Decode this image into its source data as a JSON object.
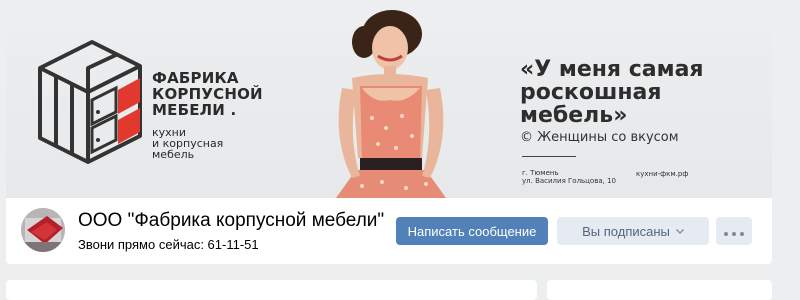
{
  "cover": {
    "logo_title_lines": [
      "ФАБРИКА",
      "КОРПУСНОЙ",
      "МЕБЕЛИ ."
    ],
    "logo_sub_lines": [
      "кухни",
      "и корпусная",
      "мебель"
    ],
    "quote_lines": [
      "«У меня самая",
      "роскошная",
      "мебель»"
    ],
    "quote_author": "© Женщины со вкусом",
    "address_lines": [
      "г. Тюмень",
      "ул. Василия Гольцова, 10"
    ],
    "website": "кухни-фкм.рф"
  },
  "group": {
    "name": "ООО \"Фабрика корпусной мебели\"",
    "status": "Звони прямо сейчас: 61-11-51"
  },
  "actions": {
    "message_label": "Написать сообщение",
    "subscribed_label": "Вы подписаны",
    "subscribed_chevron_icon": "chevron-down-icon",
    "more_icon": "more-dots-icon",
    "more_label": "•••"
  },
  "colors": {
    "accent": "#5181b8",
    "secondary_button": "#e5ebf1",
    "logo_red": "#e1392e",
    "page_background": "#edeef0"
  }
}
